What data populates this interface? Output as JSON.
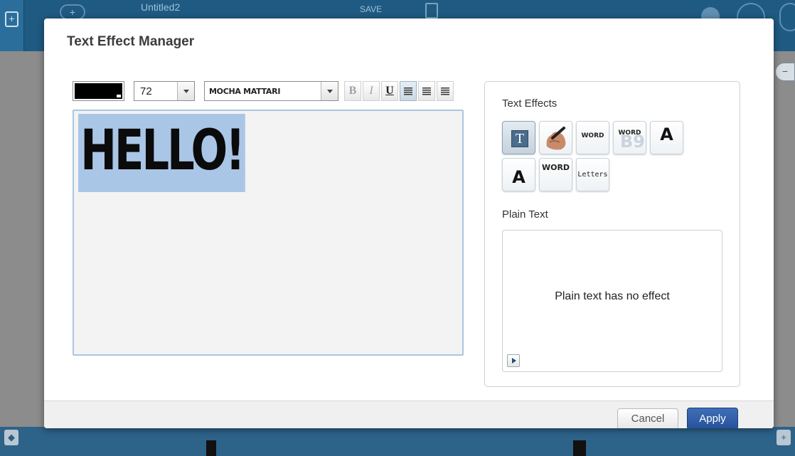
{
  "app": {
    "doc_title": "Untitled2",
    "save_label": "SAVE"
  },
  "dialog": {
    "title": "Text Effect Manager"
  },
  "toolbar": {
    "color": "#000000",
    "font_size": "72",
    "font_family": "MOCHA MATTARI",
    "bold_label": "B",
    "italic_label": "I",
    "underline_label": "U",
    "underline_active": true,
    "align_selected": "left"
  },
  "editor": {
    "text": "HELLO!"
  },
  "effects_panel": {
    "heading": "Text Effects",
    "tiles": [
      {
        "id": "plain-text",
        "icon": "text-t-icon",
        "selected": true
      },
      {
        "id": "handwriting",
        "icon": "hand-writing-icon"
      },
      {
        "id": "word-outline",
        "label": "WORD"
      },
      {
        "id": "word-shadow",
        "label": "WORD"
      },
      {
        "id": "letter-a-bold",
        "label": "A"
      },
      {
        "id": "letter-a-sketch",
        "label": "A"
      },
      {
        "id": "word-sketch",
        "label": "WORD"
      },
      {
        "id": "letters-scribble",
        "label": "Letters"
      }
    ],
    "selected_effect_name": "Plain Text",
    "preview_message": "Plain text has no effect"
  },
  "footer": {
    "cancel_label": "Cancel",
    "apply_label": "Apply"
  },
  "colors": {
    "accent": "#26519a",
    "app_header": "#1f5a82",
    "selection": "#aac6e6"
  }
}
